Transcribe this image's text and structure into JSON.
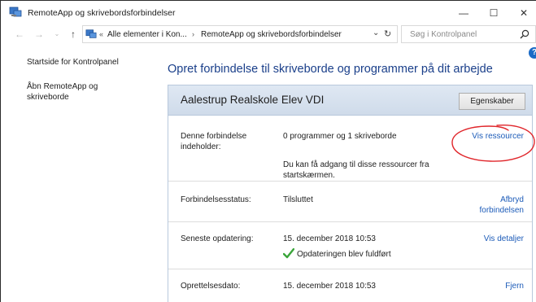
{
  "window": {
    "title": "RemoteApp og skrivebordsforbindelser",
    "controls": {
      "minimize": "—",
      "maximize": "☐",
      "close": "✕"
    }
  },
  "nav": {
    "back": "←",
    "forward": "→",
    "recent": "⌄",
    "up": "↑",
    "breadcrumb": [
      "Alle elementer i Kon...",
      "RemoteApp og skrivebordsforbindelser"
    ],
    "breadcrumb_sep": "›",
    "first_sep": "«",
    "dropdown": "⌄",
    "refresh": "↻",
    "search_placeholder": "Søg i Kontrolpanel"
  },
  "sidebar": {
    "items": [
      {
        "label": "Startside for Kontrolpanel"
      },
      {
        "label": "Åbn RemoteApp og skriveborde"
      }
    ]
  },
  "help": "?",
  "main": {
    "title": "Opret forbindelse til skriveborde og programmer på dit arbejde",
    "connection": {
      "name": "Aalestrup Realskole Elev VDI",
      "properties_button": "Egenskaber",
      "rows": [
        {
          "label": "Denne forbindelse indeholder:",
          "value": "0 programmer og 1 skriveborde",
          "value2": "Du kan få adgang til disse ressourcer fra startskærmen.",
          "action": "Vis ressourcer"
        },
        {
          "label": "Forbindelsesstatus:",
          "value": "Tilsluttet",
          "action": "Afbryd forbindelsen"
        },
        {
          "label": "Seneste opdatering:",
          "value": "15. december 2018 10:53",
          "value2": "Opdateringen blev fuldført",
          "action": "Vis detaljer"
        },
        {
          "label": "Oprettelsesdato:",
          "value": "15. december 2018 10:53",
          "action": "Fjern"
        }
      ]
    }
  },
  "colors": {
    "link": "#1c5bb8",
    "title": "#1a3f8a",
    "annotation": "#e0262b",
    "success": "#3aa53a"
  }
}
